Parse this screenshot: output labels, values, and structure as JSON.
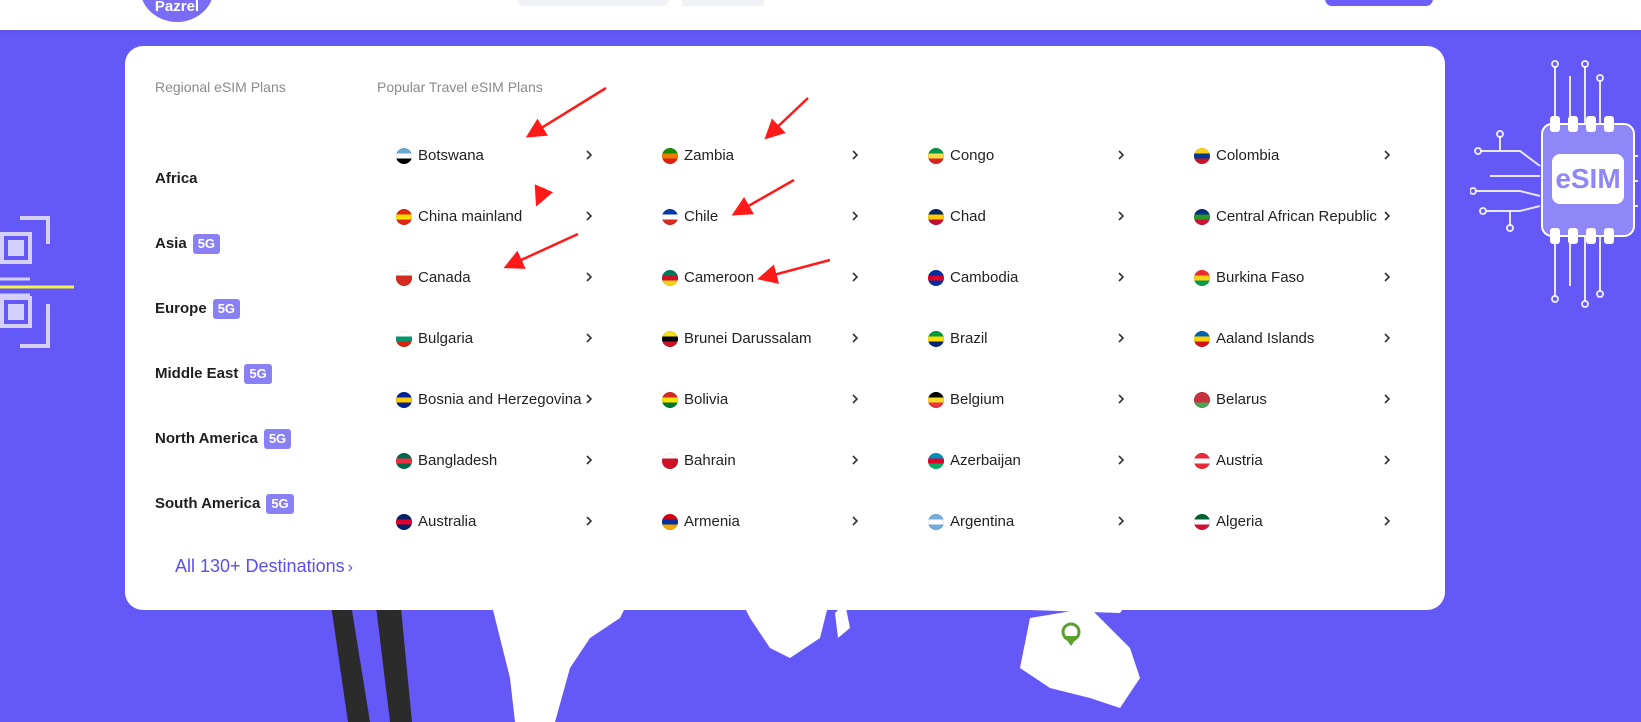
{
  "header": {
    "logo_text": "Pazrel"
  },
  "menu": {
    "regional_heading": "Regional eSIM Plans",
    "popular_heading": "Popular Travel eSIM Plans",
    "regions": [
      {
        "label": "Africa",
        "badge": ""
      },
      {
        "label": "Asia",
        "badge": "5G"
      },
      {
        "label": "Europe",
        "badge": "5G"
      },
      {
        "label": "Middle East",
        "badge": "5G"
      },
      {
        "label": "North America",
        "badge": "5G"
      },
      {
        "label": "South America",
        "badge": "5G"
      }
    ],
    "countries": [
      {
        "name": "Botswana",
        "flag": [
          "#6da9d2",
          "#ffffff",
          "#000000"
        ]
      },
      {
        "name": "Zambia",
        "flag": [
          "#198a00",
          "#ef7d00",
          "#de2010"
        ]
      },
      {
        "name": "Congo",
        "flag": [
          "#009543",
          "#fbde4a",
          "#dc241f"
        ]
      },
      {
        "name": "Colombia",
        "flag": [
          "#fcd116",
          "#003893",
          "#ce1126"
        ]
      },
      {
        "name": "China mainland",
        "flag": [
          "#de2910",
          "#ffde00",
          "#de2910"
        ]
      },
      {
        "name": "Chile",
        "flag": [
          "#0039a6",
          "#ffffff",
          "#d52b1e"
        ]
      },
      {
        "name": "Chad",
        "flag": [
          "#002664",
          "#fecb00",
          "#c60c30"
        ]
      },
      {
        "name": "Central African Republic",
        "flag": [
          "#003082",
          "#289728",
          "#d21034"
        ]
      },
      {
        "name": "Canada",
        "flag": [
          "#ffffff",
          "#d52b1e",
          "#d52b1e"
        ]
      },
      {
        "name": "Cameroon",
        "flag": [
          "#007a5e",
          "#ce1126",
          "#fcd116"
        ]
      },
      {
        "name": "Cambodia",
        "flag": [
          "#032ea1",
          "#e00025",
          "#032ea1"
        ]
      },
      {
        "name": "Burkina Faso",
        "flag": [
          "#ef2b2d",
          "#fcd116",
          "#009e49"
        ]
      },
      {
        "name": "Bulgaria",
        "flag": [
          "#ffffff",
          "#00966e",
          "#d62612"
        ]
      },
      {
        "name": "Brunei Darussalam",
        "flag": [
          "#f7e017",
          "#000000",
          "#cf1126"
        ]
      },
      {
        "name": "Brazil",
        "flag": [
          "#009c3b",
          "#ffdf00",
          "#002776"
        ]
      },
      {
        "name": "Aaland Islands",
        "flag": [
          "#0064ad",
          "#ffd300",
          "#da0e15"
        ]
      },
      {
        "name": "Bosnia and Herzegovina",
        "flag": [
          "#002395",
          "#fecb00",
          "#002395"
        ]
      },
      {
        "name": "Bolivia",
        "flag": [
          "#d52b1e",
          "#f9e300",
          "#007934"
        ]
      },
      {
        "name": "Belgium",
        "flag": [
          "#000000",
          "#fdda24",
          "#ef3340"
        ]
      },
      {
        "name": "Belarus",
        "flag": [
          "#c8313e",
          "#c8313e",
          "#4aa657"
        ]
      },
      {
        "name": "Bangladesh",
        "flag": [
          "#006a4e",
          "#f42a41",
          "#006a4e"
        ]
      },
      {
        "name": "Bahrain",
        "flag": [
          "#ffffff",
          "#ce1126",
          "#ce1126"
        ]
      },
      {
        "name": "Azerbaijan",
        "flag": [
          "#0092bc",
          "#e4002b",
          "#00af66"
        ]
      },
      {
        "name": "Austria",
        "flag": [
          "#ed2939",
          "#ffffff",
          "#ed2939"
        ]
      },
      {
        "name": "Australia",
        "flag": [
          "#012169",
          "#e4002b",
          "#012169"
        ]
      },
      {
        "name": "Armenia",
        "flag": [
          "#d90012",
          "#0033a0",
          "#f2a800"
        ]
      },
      {
        "name": "Argentina",
        "flag": [
          "#74acdf",
          "#ffffff",
          "#74acdf"
        ]
      },
      {
        "name": "Algeria",
        "flag": [
          "#006233",
          "#ffffff",
          "#d21034"
        ]
      }
    ],
    "all_destinations": "All 130+ Destinations",
    "all_arrow": "›"
  },
  "decor": {
    "chip_text": "eSIM"
  },
  "colors": {
    "background": "#6458f6",
    "accent": "#5a4ff0",
    "badge": "#8a80f5",
    "annotation": "#ff1a1a"
  }
}
